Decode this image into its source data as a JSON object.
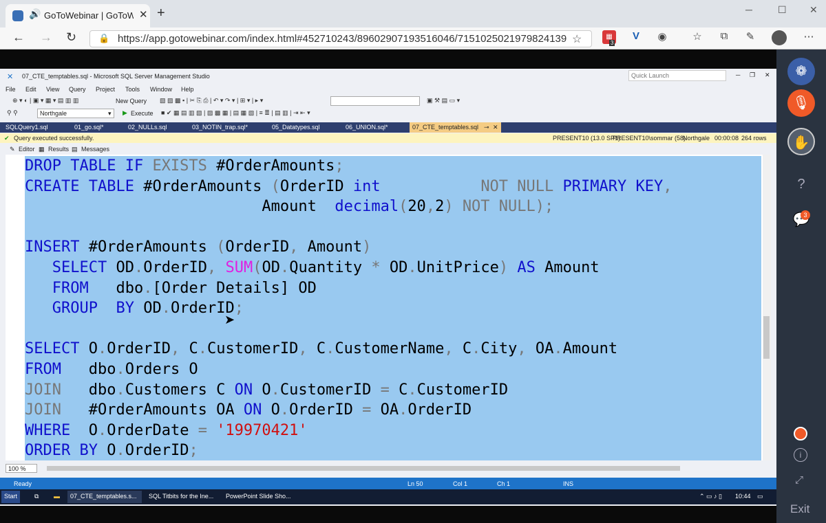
{
  "browser": {
    "tab_title": "GoToWebinar | GoToWebinar",
    "url": "https://app.gotowebinar.com/index.html#452710243/8960290719351604 6/7151025021979824139",
    "url_full": "https://app.gotowebinar.com/index.html#452710243/89602907193516046/7151025021979824139",
    "badge_count": "3",
    "new_tab": "+",
    "win_min": "─",
    "win_max": "☐",
    "win_close": "✕"
  },
  "ssms": {
    "title": "07_CTE_temptables.sql - Microsoft SQL Server Management Studio",
    "quick_launch": "Quick Launch",
    "menu": [
      "File",
      "Edit",
      "View",
      "Query",
      "Project",
      "Tools",
      "Window",
      "Help"
    ],
    "new_query": "New Query",
    "database": "Northgale",
    "execute": "Execute",
    "tabs": [
      "SQLQuery1.sql",
      "01_go.sql*",
      "02_NULLs.sql",
      "03_NOTIN_trap.sql*",
      "05_Datatypes.sql",
      "06_UNION.sql*",
      "07_CTE_temptables.sql"
    ],
    "status_msg": "Query executed successfully.",
    "status_right": [
      "PRESENT10 (13.0 SP1)",
      "PRESENT10\\sommar (58)",
      "Northgale",
      "00:00:08",
      "264 rows"
    ],
    "subtabs": [
      "Editor",
      "Results",
      "Messages"
    ],
    "zoom": "100 %",
    "ready": "Ready",
    "ln": "Ln 50",
    "col": "Col 1",
    "ch": "Ch 1",
    "ins": "INS"
  },
  "taskbar": {
    "start": "Start",
    "items": [
      "07_CTE_temptables.s...",
      "SQL Titbits for the Ine...",
      "PowerPoint Slide Sho..."
    ],
    "time": "10:44"
  },
  "panel": {
    "badge": "3",
    "exit": "Exit"
  }
}
